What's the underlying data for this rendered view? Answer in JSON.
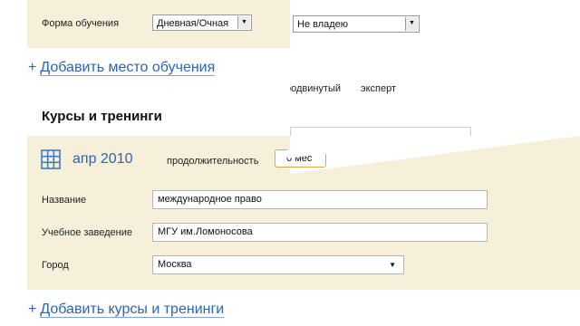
{
  "education": {
    "form_label": "Форма обучения",
    "form_value": "Дневная/Очная",
    "level_value": "Не владею",
    "add_place_label": "Добавить место обучения"
  },
  "language_levels": {
    "advanced": "продвинутый",
    "expert": "эксперт"
  },
  "courses": {
    "heading": "Курсы и тренинги",
    "date_label": "апр 2010",
    "duration_label": "продолжительность",
    "duration_value": "6 мес",
    "name_label": "Название",
    "name_value": "международное право",
    "institution_label": "Учебное заведение",
    "institution_value": "МГУ им.Ломоносова",
    "city_label": "Город",
    "city_value": "Москва",
    "add_label": "Добавить курсы и тренинги"
  },
  "colors": {
    "panel": "#f6efd9",
    "link": "#2867b5",
    "calendar": "#3c7dc4"
  }
}
